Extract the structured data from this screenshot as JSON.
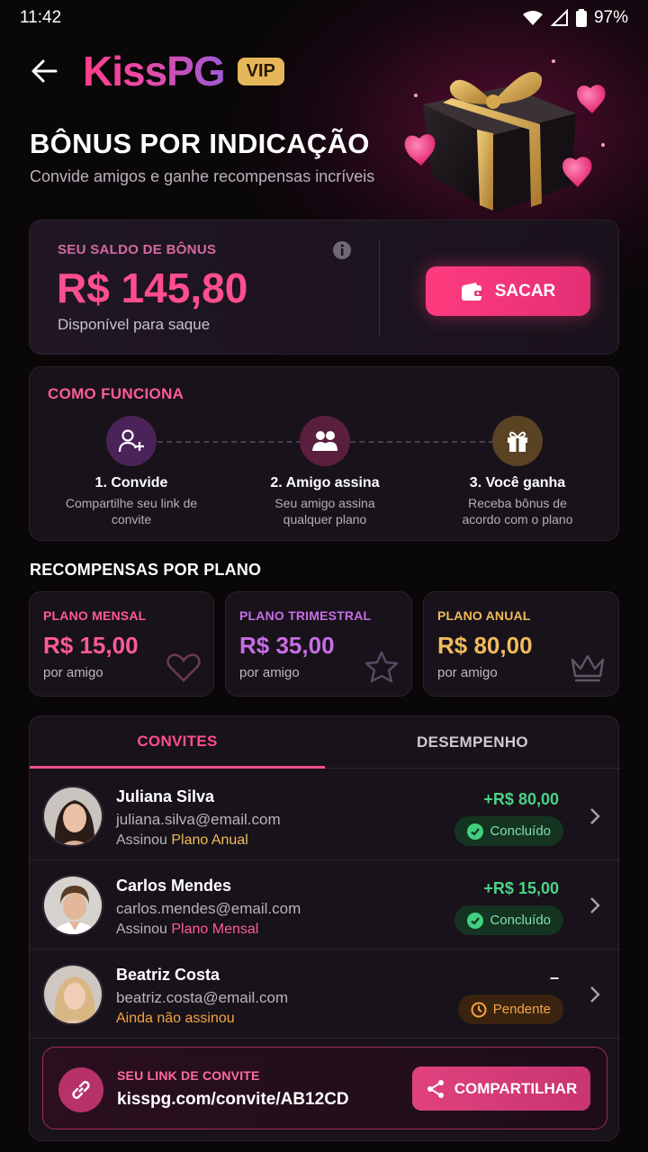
{
  "status_bar": {
    "time": "11:42",
    "battery": "97%"
  },
  "header": {
    "logo": "KissPG",
    "vip_badge": "VIP"
  },
  "page": {
    "title": "BÔNUS POR INDICAÇÃO",
    "subtitle": "Convide amigos e ganhe recompensas incríveis"
  },
  "balance": {
    "label": "SEU SALDO DE BÔNUS",
    "value": "R$ 145,80",
    "sub": "Disponível para saque",
    "button": "SACAR"
  },
  "how_it_works": {
    "title": "COMO FUNCIONA",
    "steps": [
      {
        "title": "1. Convide",
        "desc": "Compartilhe seu link de convite",
        "icon": "add-user-icon",
        "color": "#4a2358"
      },
      {
        "title": "2. Amigo assina",
        "desc": "Seu amigo assina qualquer plano",
        "icon": "friends-icon",
        "color": "#5a1f3c"
      },
      {
        "title": "3. Você ganha",
        "desc": "Receba bônus de acordo com o plano",
        "icon": "gift-icon",
        "color": "#5a4322"
      }
    ]
  },
  "rewards": {
    "title": "RECOMPENSAS POR PLANO",
    "plans": [
      {
        "name": "PLANO MENSAL",
        "price": "R$ 15,00",
        "sub": "por amigo",
        "color": "#ff5a9a",
        "icon": "heart-icon"
      },
      {
        "name": "PLANO TRIMESTRAL",
        "price": "R$ 35,00",
        "sub": "por amigo",
        "color": "#c86ee6",
        "icon": "star-icon"
      },
      {
        "name": "PLANO ANUAL",
        "price": "R$ 80,00",
        "sub": "por amigo",
        "color": "#f0bb5c",
        "icon": "crown-icon"
      }
    ]
  },
  "tabs": {
    "invites": "CONVITES",
    "performance": "DESEMPENHO",
    "active": "invites"
  },
  "invites": [
    {
      "name": "Juliana Silva",
      "email": "juliana.silva@email.com",
      "plan_prefix": "Assinou ",
      "plan": "Plano Anual",
      "plan_color": "#f0bb5c",
      "amount": "+R$ 80,00",
      "status": "Concluído"
    },
    {
      "name": "Carlos Mendes",
      "email": "carlos.mendes@email.com",
      "plan_prefix": "Assinou ",
      "plan": "Plano Mensal",
      "plan_color": "#ff5a9a",
      "amount": "+R$ 15,00",
      "status": "Concluído"
    },
    {
      "name": "Beatriz Costa",
      "email": "beatriz.costa@email.com",
      "plan_prefix": "",
      "plan": "Ainda não assinou",
      "plan_color": "#f5a442",
      "amount": "–",
      "status": "Pendente"
    }
  ],
  "invite_link": {
    "label": "SEU LINK DE CONVITE",
    "url": "kisspg.com/convite/AB12CD",
    "button": "COMPARTILHAR"
  }
}
